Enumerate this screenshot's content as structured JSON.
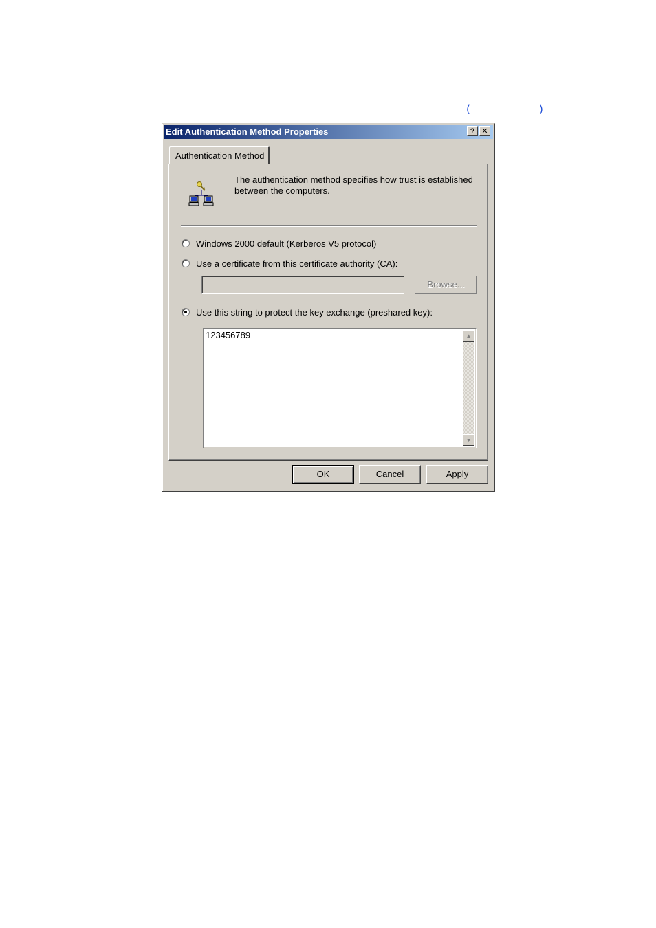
{
  "decor": {
    "paren_open": "(",
    "paren_close": ")"
  },
  "window": {
    "title": "Edit Authentication Method Properties",
    "help_button": "?",
    "close_button": "✕"
  },
  "tabs": [
    {
      "label": "Authentication Method",
      "selected": true
    }
  ],
  "panel": {
    "icon": "network-key-icon",
    "description": "The authentication method specifies how trust is established between the computers.",
    "options": {
      "kerberos_label": "Windows 2000 default (Kerberos V5 protocol)",
      "certificate_label": "Use a certificate from this certificate authority (CA):",
      "preshared_label": "Use this string to protect the key exchange (preshared key):",
      "selected": "preshared"
    },
    "ca_input_value": "",
    "browse_label": "Browse...",
    "preshared_value": "123456789"
  },
  "footer": {
    "ok_label": "OK",
    "cancel_label": "Cancel",
    "apply_label": "Apply"
  },
  "colors": {
    "face": "#d4d0c8",
    "titlebar_start": "#0a246a",
    "titlebar_end": "#a6caf0",
    "paren_accent": "#1f4fd8"
  }
}
